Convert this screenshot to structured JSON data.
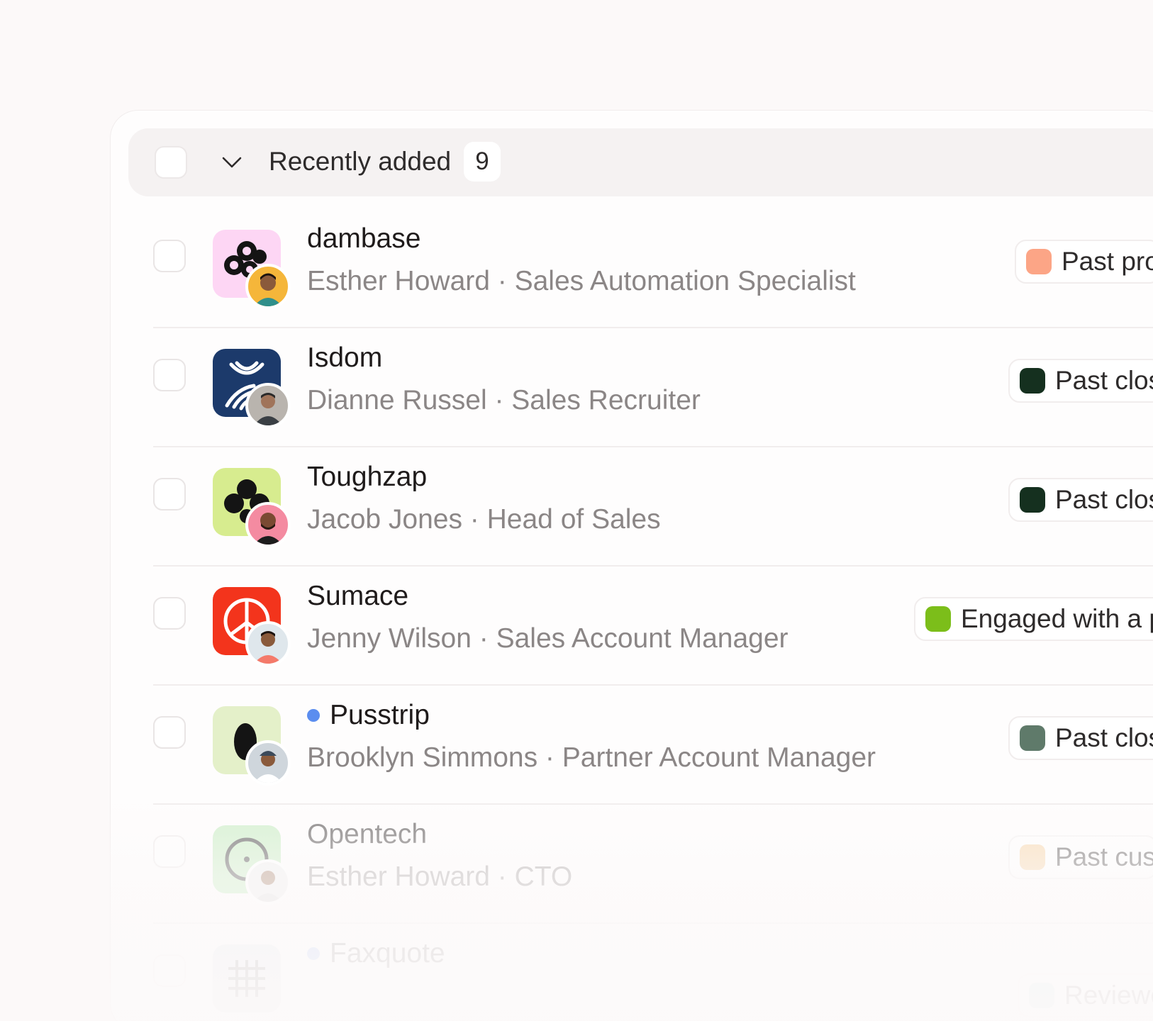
{
  "group": {
    "title": "Recently added",
    "count": "9"
  },
  "rows": [
    {
      "company": "dambase",
      "person": "Esther Howard",
      "role": "Sales Automation Specialist",
      "subtitle": "Esther Howard · Sales Automation Specialist",
      "status": "Past pro",
      "status_color": "#fca586",
      "logo_icon": "dambase-logo-icon",
      "unread": false
    },
    {
      "company": "Isdom",
      "person": "Dianne Russel",
      "role": "Sales Recruiter",
      "subtitle": "Dianne Russel · Sales Recruiter",
      "status": "Past clos",
      "status_color": "#15301f",
      "logo_icon": "isdom-logo-icon",
      "unread": false
    },
    {
      "company": "Toughzap",
      "person": "Jacob Jones",
      "role": "Head of Sales",
      "subtitle": "Jacob Jones · Head of Sales",
      "status": "Past clos",
      "status_color": "#15301f",
      "logo_icon": "toughzap-logo-icon",
      "unread": false
    },
    {
      "company": "Sumace",
      "person": "Jenny Wilson",
      "role": "Sales Account Manager",
      "subtitle": "Jenny Wilson · Sales Account Manager",
      "status": "Engaged with a p",
      "status_color": "#7cbe1a",
      "logo_icon": "sumace-logo-icon",
      "unread": false
    },
    {
      "company": "Pusstrip",
      "person": "Brooklyn Simmons",
      "role": "Partner Account Manager",
      "subtitle": "Brooklyn Simmons · Partner Account Manager",
      "status": "Past clos",
      "status_color": "#5f7a6a",
      "logo_icon": "pusstrip-logo-icon",
      "unread": true
    },
    {
      "company": "Opentech",
      "person": "Esther Howard",
      "role": "CTO",
      "subtitle": "Esther Howard · CTO",
      "status": "Past cus",
      "status_color": "#f6c98f",
      "logo_icon": "opentech-logo-icon",
      "unread": false
    },
    {
      "company": "Faxquote",
      "person": "",
      "role": "",
      "subtitle": "",
      "status": "Reviewe",
      "status_color": "#a7dcd0",
      "logo_icon": "faxquote-logo-icon",
      "unread": true
    }
  ]
}
